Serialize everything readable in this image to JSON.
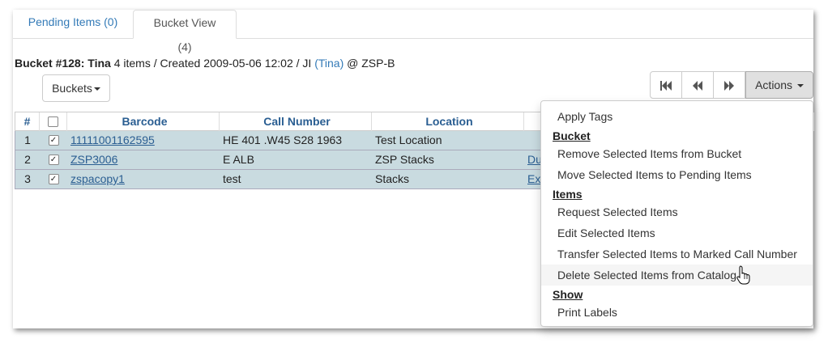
{
  "tabs": [
    {
      "label": "Pending Items (0)"
    },
    {
      "label": "Bucket View (4)"
    }
  ],
  "bucket": {
    "title": "Bucket #128:",
    "name": "Tina",
    "meta": " 4 items / Created 2009-05-06 12:02 / JI ",
    "owner": "(Tina)",
    "location": " @ ZSP-B"
  },
  "toolbar": {
    "buckets_label": "Buckets",
    "actions_label": "Actions"
  },
  "table": {
    "headers": [
      "#",
      "",
      "Barcode",
      "Call Number",
      "Location",
      ""
    ],
    "rows": [
      {
        "num": "1",
        "checked": "✓",
        "barcode": "11111001162595",
        "call_number": "HE 401 .W45 S28 1963",
        "location": "Test Location",
        "extra": ""
      },
      {
        "num": "2",
        "checked": "✓",
        "barcode": "ZSP3006",
        "call_number": "E ALB",
        "location": "ZSP Stacks",
        "extra": "Du"
      },
      {
        "num": "3",
        "checked": "✓",
        "barcode": "zspacopy1",
        "call_number": "test",
        "location": "Stacks",
        "extra": "Ex"
      }
    ]
  },
  "actions_menu": {
    "apply_tags": "Apply Tags",
    "bucket_header": "Bucket",
    "remove_from_bucket": "Remove Selected Items from Bucket",
    "move_to_pending": "Move Selected Items to Pending Items",
    "items_header": "Items",
    "request_items": "Request Selected Items",
    "edit_items": "Edit Selected Items",
    "transfer_items": "Transfer Selected Items to Marked Call Number",
    "delete_items": "Delete Selected Items from Catalog",
    "show_header": "Show",
    "print_labels": "Print Labels"
  },
  "colors": {
    "link": "#337ab7",
    "row_selected": "#c9dbe0",
    "header_text": "#2a5e92"
  }
}
